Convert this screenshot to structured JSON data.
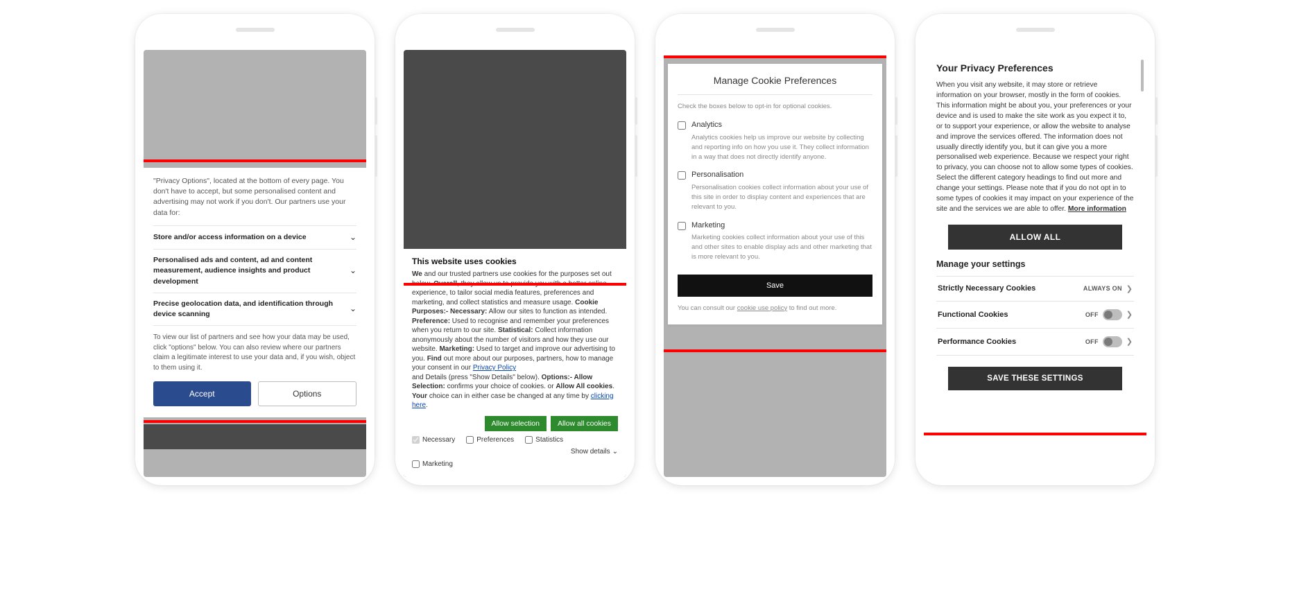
{
  "phone1": {
    "intro": "\"Privacy Options\", located at the bottom of every page. You don't have to accept, but some personalised content and advertising may not work if you don't. Our partners use your data for:",
    "items": [
      "Store and/or access information on a device",
      "Personalised ads and content, ad and content measurement, audience insights and product development",
      "Precise geolocation data, and identification through device scanning"
    ],
    "note": "To view our list of partners and see how your data may be used, click \"options\" below. You can also review where our partners claim a legitimate interest to use your data and, if you wish, object to them using it.",
    "accept": "Accept",
    "options": "Options"
  },
  "phone2": {
    "title": "This website uses cookies",
    "body_parts": {
      "we": "We",
      "t1": " and our trusted partners use cookies for the purposes set out below. ",
      "overall": "Overall",
      "t2": ", they allow us to provide you with a better online experience, to tailor social media features, preferences and marketing, and collect statistics and measure usage. ",
      "cp": "Cookie Purposes:- Necessary:",
      "t3": " Allow our sites to function as intended. ",
      "pref": "Preference:",
      "t4": " Used to recognise and remember your preferences when you return to our site. ",
      "stat": "Statistical:",
      "t5": " Collect information anonymously about the number of visitors and how they use our website. ",
      "mkt": "Marketing:",
      "t6": " Used to target and improve our advertising to you. ",
      "find": "Find",
      "t7": " out more about our purposes, partners, how to manage your consent in our ",
      "pp": "Privacy Policy",
      "t8": " and Details (press \"Show Details\" below). ",
      "opt": "Options:- Allow Selection:",
      "t9": " confirms your choice of cookies. or ",
      "aac": "Allow All cookies",
      "t10": ". ",
      "your": "Your",
      "t11": " choice can in either case be changed at any time by ",
      "ch": "clicking here",
      "t12": "."
    },
    "allow_selection": "Allow selection",
    "allow_all": "Allow all cookies",
    "checks": {
      "necessary": "Necessary",
      "preferences": "Preferences",
      "statistics": "Statistics",
      "marketing": "Marketing"
    },
    "show_details": "Show details"
  },
  "phone3": {
    "title": "Manage Cookie Preferences",
    "sub": "Check the boxes below to opt-in for optional cookies.",
    "opts": [
      {
        "label": "Analytics",
        "desc": "Analytics cookies help us improve our website by collecting and reporting info on how you use it. They collect information in a way that does not directly identify anyone."
      },
      {
        "label": "Personalisation",
        "desc": "Personalisation cookies collect information about your use of this site in order to display content and experiences that are relevant to you."
      },
      {
        "label": "Marketing",
        "desc": "Marketing cookies collect information about your use of this and other sites to enable display ads and other marketing that is more relevant to you."
      }
    ],
    "save": "Save",
    "foot_pre": "You can consult our ",
    "foot_link": "cookie use policy",
    "foot_post": " to find out more."
  },
  "phone4": {
    "title": "Your Privacy Preferences",
    "body": "When you visit any website, it may store or retrieve information on your browser, mostly in the form of cookies. This information might be about you, your preferences or your device and is used to make the site work as you expect it to, or to support your experience, or allow the website to analyse and improve the services offered. The information does not usually directly identify you, but it can give you a more personalised web experience. Because we respect your right to privacy, you can choose not to allow some types of cookies. Select the different category headings to find out more and change your settings. Please note that if you do not opt in to some types of cookies it may impact on your experience of the site and the services we are able to offer.  ",
    "more": "More information",
    "allow_all": "ALLOW ALL",
    "manage": "Manage your settings",
    "rows": [
      {
        "label": "Strictly Necessary Cookies",
        "status": "ALWAYS ON",
        "toggle": false
      },
      {
        "label": "Functional Cookies",
        "status": "OFF",
        "toggle": true
      },
      {
        "label": "Performance Cookies",
        "status": "OFF",
        "toggle": true
      }
    ],
    "save": "SAVE THESE SETTINGS"
  }
}
